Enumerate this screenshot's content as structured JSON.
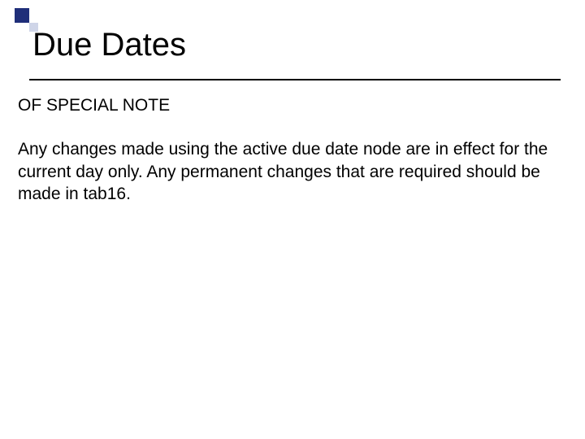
{
  "slide": {
    "title": "Due Dates",
    "subhead": "OF SPECIAL NOTE",
    "body": "Any changes made using the active due date node are in effect for the current day only.  Any permanent changes that are required should be made in tab16."
  }
}
